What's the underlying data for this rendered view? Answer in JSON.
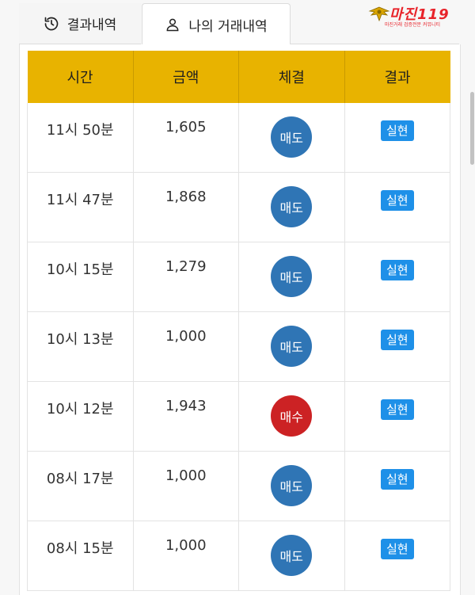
{
  "tabs": [
    {
      "label": "결과내역",
      "icon": "history-icon"
    },
    {
      "label": "나의 거래내역",
      "icon": "user-icon"
    }
  ],
  "logo": {
    "main": "마진119",
    "sub": "마진거래 검증전문 커뮤니티"
  },
  "table": {
    "headers": [
      "시간",
      "금액",
      "체결",
      "결과"
    ],
    "rows": [
      {
        "time": "11시 50분",
        "amount": "1,605",
        "trade": "매도",
        "trade_type": "sell",
        "result": "실현"
      },
      {
        "time": "11시 47분",
        "amount": "1,868",
        "trade": "매도",
        "trade_type": "sell",
        "result": "실현"
      },
      {
        "time": "10시 15분",
        "amount": "1,279",
        "trade": "매도",
        "trade_type": "sell",
        "result": "실현"
      },
      {
        "time": "10시 13분",
        "amount": "1,000",
        "trade": "매도",
        "trade_type": "sell",
        "result": "실현"
      },
      {
        "time": "10시 12분",
        "amount": "1,943",
        "trade": "매수",
        "trade_type": "buy",
        "result": "실현"
      },
      {
        "time": "08시 17분",
        "amount": "1,000",
        "trade": "매도",
        "trade_type": "sell",
        "result": "실현"
      },
      {
        "time": "08시 15분",
        "amount": "1,000",
        "trade": "매도",
        "trade_type": "sell",
        "result": "실현"
      }
    ]
  },
  "colors": {
    "header_bg": "#e8b300",
    "sell": "#2f75b5",
    "buy": "#cc2224",
    "result": "#1e90e8"
  }
}
